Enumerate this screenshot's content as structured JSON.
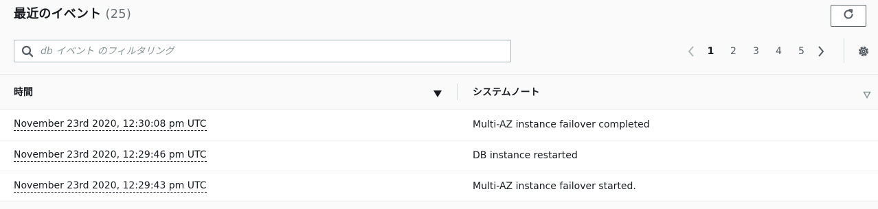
{
  "header": {
    "title": "最近のイベント",
    "count": "(25)",
    "refresh_icon": "refresh-icon"
  },
  "search": {
    "placeholder": "db イベント のフィルタリング",
    "value": ""
  },
  "pagination": {
    "pages": [
      "1",
      "2",
      "3",
      "4",
      "5"
    ],
    "current": "1"
  },
  "table": {
    "columns": {
      "time": "時間",
      "note": "システムノート"
    },
    "rows": [
      {
        "time": "November 23rd 2020, 12:30:08 pm UTC",
        "note": "Multi-AZ instance failover completed"
      },
      {
        "time": "November 23rd 2020, 12:29:46 pm UTC",
        "note": "DB instance restarted"
      },
      {
        "time": "November 23rd 2020, 12:29:43 pm UTC",
        "note": "Multi-AZ instance failover started."
      }
    ]
  }
}
